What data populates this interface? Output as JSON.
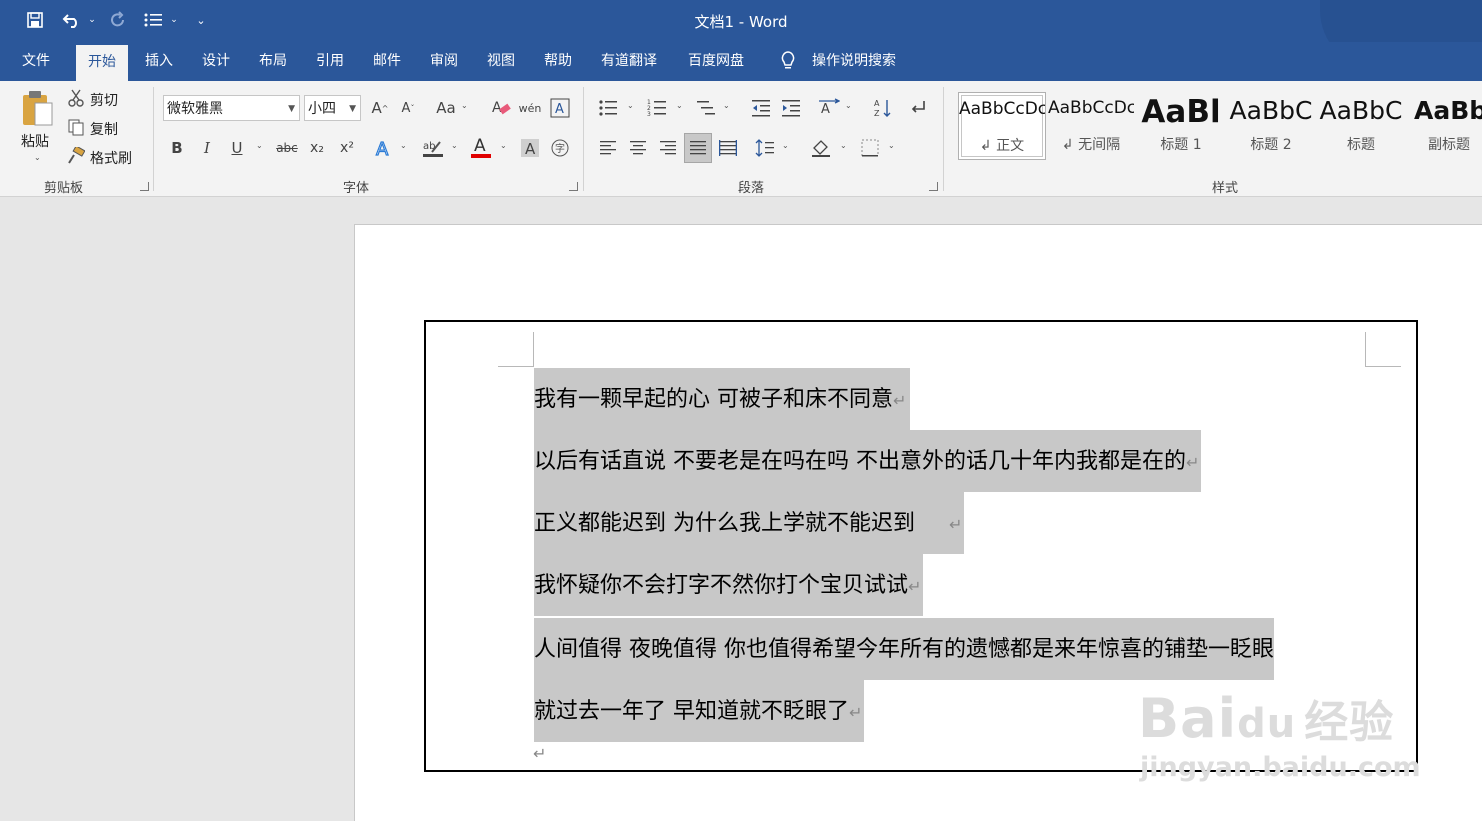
{
  "window": {
    "title": "文档1  -  Word"
  },
  "qat": {
    "save_icon": "save-icon",
    "undo_icon": "undo-icon",
    "redo_icon": "redo-icon",
    "list_icon": "bullet-list-icon"
  },
  "tabs": [
    "文件",
    "开始",
    "插入",
    "设计",
    "布局",
    "引用",
    "邮件",
    "审阅",
    "视图",
    "帮助",
    "有道翻译",
    "百度网盘"
  ],
  "active_tab": "开始",
  "tell_me": "操作说明搜索",
  "clipboard": {
    "paste": "粘贴",
    "cut": "剪切",
    "copy": "复制",
    "format_painter": "格式刷",
    "group": "剪贴板"
  },
  "font": {
    "name": "微软雅黑",
    "size": "小四",
    "group": "字体",
    "change_case": "Aa",
    "bold": "B",
    "italic": "I",
    "underline": "U",
    "strike": "abc",
    "subscript": "x₂",
    "superscript": "x²",
    "font_color": "#e00000"
  },
  "paragraph": {
    "group": "段落"
  },
  "styles": {
    "group": "样式",
    "items": [
      {
        "preview": "AaBbCcDc",
        "name": "↲ 正文"
      },
      {
        "preview": "AaBbCcDc",
        "name": "↲ 无间隔"
      },
      {
        "preview": "AaBl",
        "name": "标题 1"
      },
      {
        "preview": "AaBbC",
        "name": "标题 2"
      },
      {
        "preview": "AaBbC",
        "name": "标题"
      },
      {
        "preview": "AaBb",
        "name": "副标题"
      }
    ]
  },
  "document": {
    "lines": [
      "我有一颗早起的心  可被子和床不同意",
      "以后有话直说  不要老是在吗在吗  不出意外的话几十年内我都是在的",
      "正义都能迟到  为什么我上学就不能迟到",
      "我怀疑你不会打字不然你打个宝贝试试",
      "人间值得  夜晚值得  你也值得希望今年所有的遗憾都是来年惊喜的铺垫一眨眼",
      "就过去一年了  早知道就不眨眼了"
    ],
    "paragraph_mark": "↵"
  },
  "watermark": {
    "brand": "Bai",
    "brand2": "du",
    "cn": "经验",
    "url": "jingyan.baidu.com"
  }
}
